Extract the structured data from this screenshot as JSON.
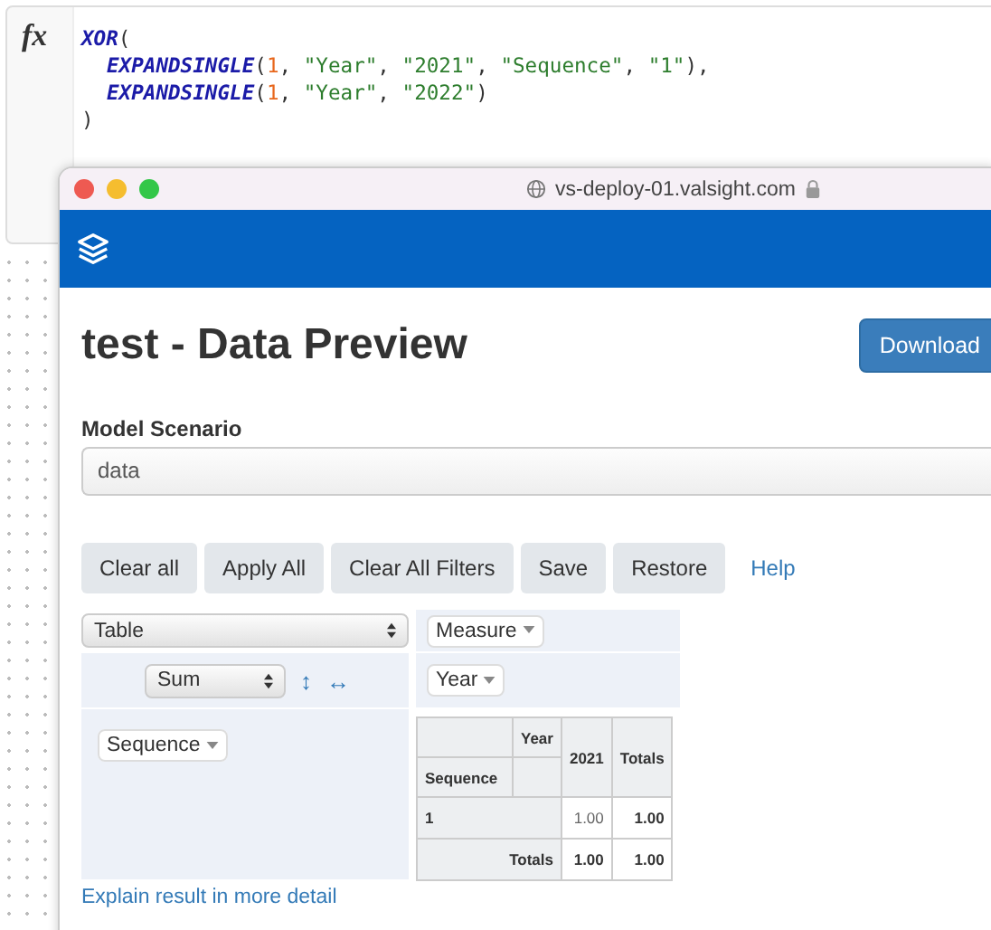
{
  "formula": {
    "label": "fx",
    "lines": [
      {
        "indent": false,
        "tokens": [
          {
            "kind": "func",
            "text": "XOR"
          },
          {
            "kind": "punct",
            "text": "("
          }
        ]
      },
      {
        "indent": true,
        "tokens": [
          {
            "kind": "func",
            "text": "EXPANDSINGLE"
          },
          {
            "kind": "punct",
            "text": "("
          },
          {
            "kind": "num",
            "text": "1"
          },
          {
            "kind": "punct",
            "text": ", "
          },
          {
            "kind": "str",
            "text": "\"Year\""
          },
          {
            "kind": "punct",
            "text": ", "
          },
          {
            "kind": "str",
            "text": "\"2021\""
          },
          {
            "kind": "punct",
            "text": ", "
          },
          {
            "kind": "str",
            "text": "\"Sequence\""
          },
          {
            "kind": "punct",
            "text": ", "
          },
          {
            "kind": "str",
            "text": "\"1\""
          },
          {
            "kind": "punct",
            "text": "),"
          }
        ]
      },
      {
        "indent": true,
        "tokens": [
          {
            "kind": "func",
            "text": "EXPANDSINGLE"
          },
          {
            "kind": "punct",
            "text": "("
          },
          {
            "kind": "num",
            "text": "1"
          },
          {
            "kind": "punct",
            "text": ", "
          },
          {
            "kind": "str",
            "text": "\"Year\""
          },
          {
            "kind": "punct",
            "text": ", "
          },
          {
            "kind": "str",
            "text": "\"2022\""
          },
          {
            "kind": "punct",
            "text": ")"
          }
        ]
      },
      {
        "indent": false,
        "tokens": [
          {
            "kind": "punct",
            "text": ")"
          }
        ]
      }
    ]
  },
  "browser": {
    "url": "vs-deploy-01.valsight.com"
  },
  "page": {
    "title": "test - Data Preview",
    "download_button": "Download",
    "scenario": {
      "label": "Model Scenario",
      "value": "data"
    },
    "toolbar": [
      {
        "kind": "button",
        "label": "Clear all"
      },
      {
        "kind": "button",
        "label": "Apply All"
      },
      {
        "kind": "button",
        "label": "Clear All Filters"
      },
      {
        "kind": "button",
        "label": "Save"
      },
      {
        "kind": "button",
        "label": "Restore"
      },
      {
        "kind": "link",
        "label": "Help"
      }
    ],
    "pivot": {
      "renderer": "Table",
      "aggregator": "Sum",
      "row_order_icon": "↕",
      "col_order_icon": "↔",
      "column_fields": [
        "Measure",
        "Year"
      ],
      "row_fields": [
        "Sequence"
      ],
      "table": {
        "col_attr": "Year",
        "row_attr": "Sequence",
        "columns": [
          "2021"
        ],
        "totals_col_label": "Totals",
        "rows": [
          {
            "label": "1",
            "values": [
              "1.00"
            ],
            "total": "1.00"
          }
        ],
        "totals_row": {
          "label": "Totals",
          "values": [
            "1.00"
          ],
          "total": "1.00"
        }
      }
    },
    "footer_link": "Explain result in more detail"
  }
}
